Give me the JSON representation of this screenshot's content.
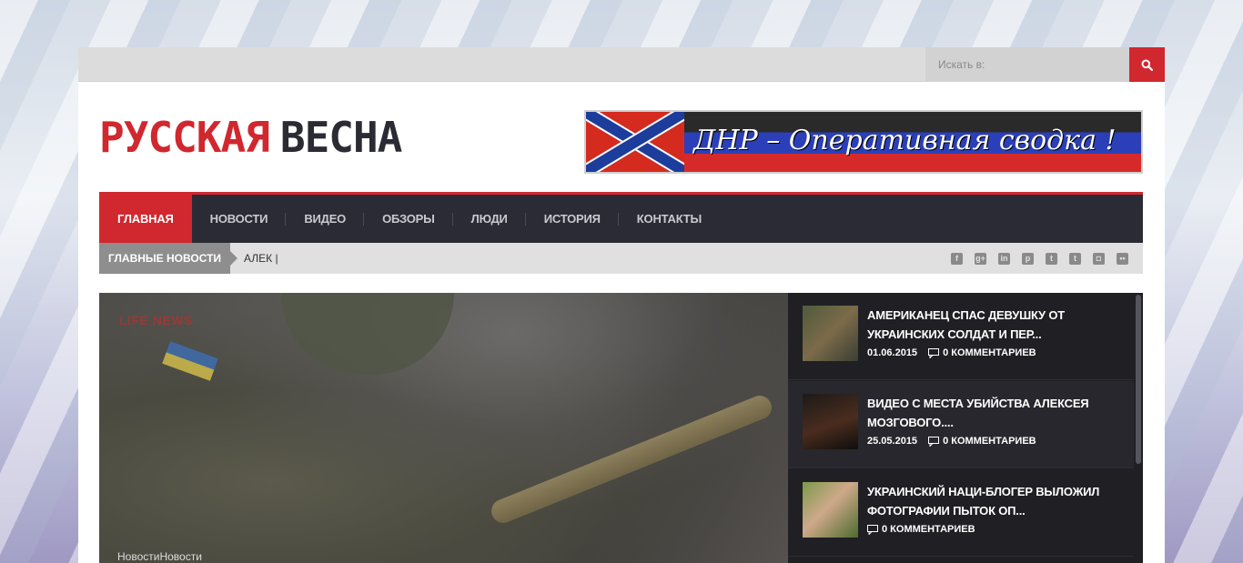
{
  "search": {
    "placeholder": "Искать в:"
  },
  "logo": {
    "word1": "РУССКАЯ",
    "word2": "ВЕСНА"
  },
  "banner": {
    "text": "ДНР – Оперативная сводка !"
  },
  "nav": {
    "items": [
      {
        "label": "ГЛАВНАЯ"
      },
      {
        "label": "НОВОСТИ"
      },
      {
        "label": "ВИДЕО"
      },
      {
        "label": "ОБЗОРЫ"
      },
      {
        "label": "ЛЮДИ"
      },
      {
        "label": "ИСТОРИЯ"
      },
      {
        "label": "КОНТАКТЫ"
      }
    ]
  },
  "ticker": {
    "label": "ГЛАВНЫЕ НОВОСТИ",
    "text": "АЛЕК |"
  },
  "social": [
    "facebook-icon",
    "google-plus-icon",
    "linkedin-icon",
    "pinterest-icon",
    "twitter-icon",
    "tumblr-icon",
    "instagram-icon",
    "flickr-icon"
  ],
  "hero": {
    "watermark": "LIFE NEWS",
    "caption": "НовостиНовости"
  },
  "sidebar": {
    "posts": [
      {
        "title": "АМЕРИКАНЕЦ СПАС ДЕВУШКУ ОТ УКРАИНСКИХ СОЛДАТ И ПЕР...",
        "date": "01.06.2015",
        "comments": "0 КОММЕНТАРИЕВ"
      },
      {
        "title": "ВИДЕО С МЕСТА УБИЙСТВА АЛЕКСЕЯ МОЗГОВОГО....",
        "date": "25.05.2015",
        "comments": "0 КОММЕНТАРИЕВ"
      },
      {
        "title": "УКРАИНСКИЙ НАЦИ-БЛОГЕР ВЫЛОЖИЛ ФОТОГРАФИИ ПЫТОК ОП...",
        "date": "",
        "comments": "0 КОММЕНТАРИЕВ"
      }
    ]
  },
  "colors": {
    "accent": "#d1272e",
    "nav_bg": "#2b2b35",
    "sidebar_bg": "#1f1f24"
  }
}
